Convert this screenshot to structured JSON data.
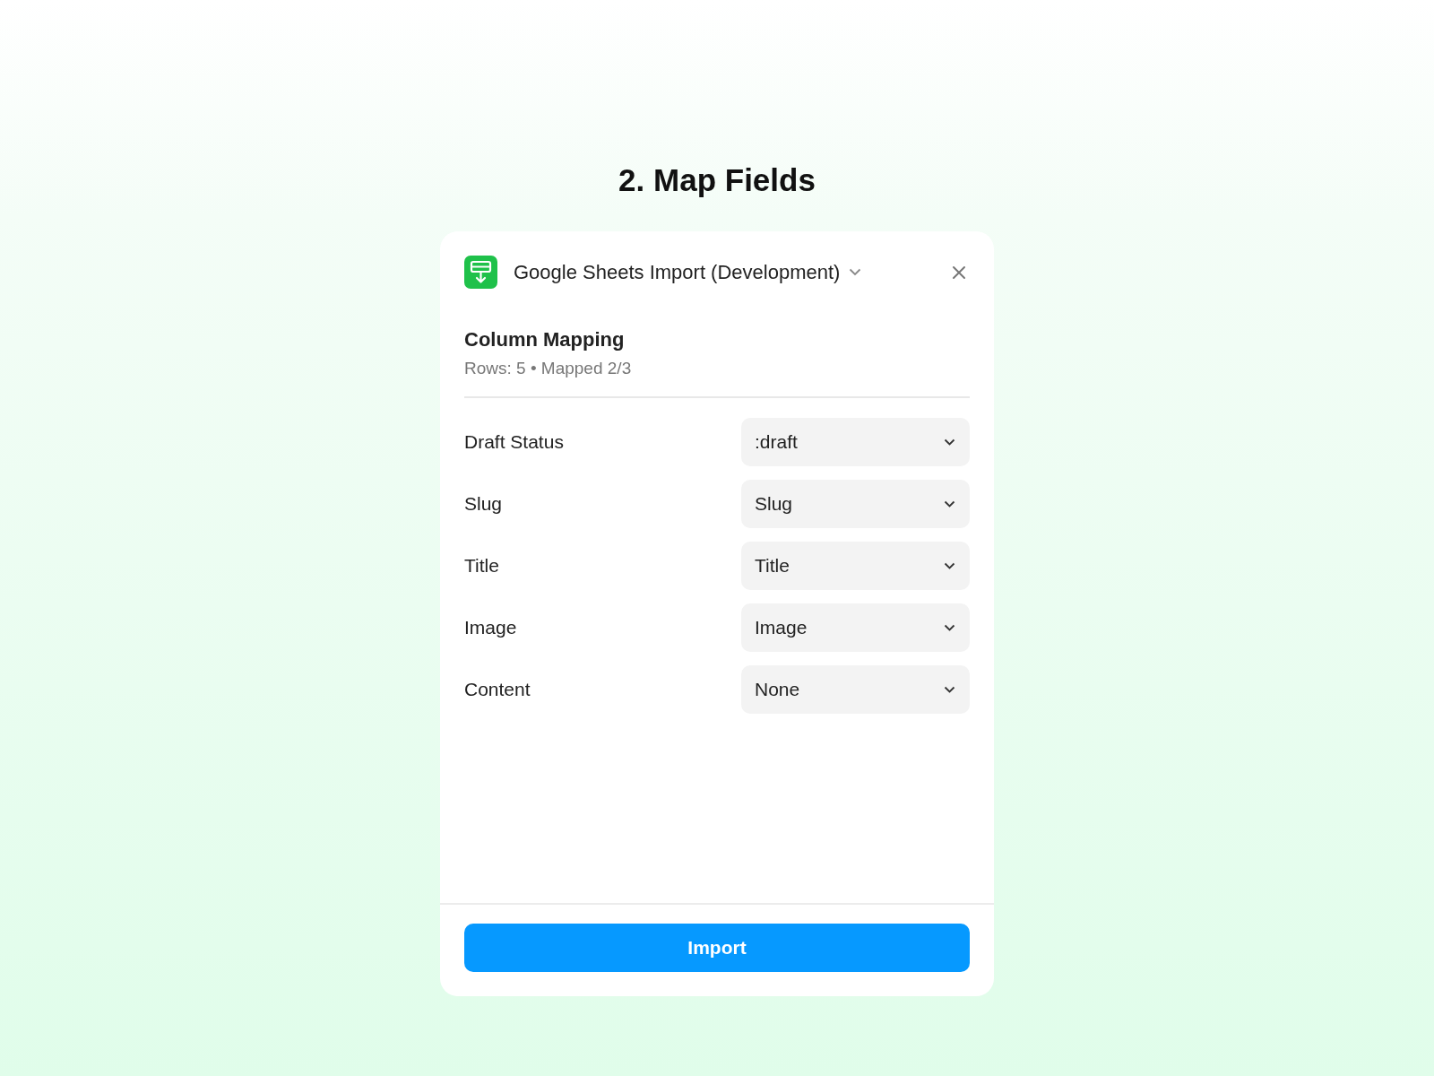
{
  "page_title": "2. Map Fields",
  "panel": {
    "title": "Google Sheets Import (Development)",
    "section_title": "Column Mapping",
    "summary": "Rows: 5 • Mapped 2/3",
    "mappings": [
      {
        "field": "Draft Status",
        "value": ":draft"
      },
      {
        "field": "Slug",
        "value": "Slug"
      },
      {
        "field": "Title",
        "value": "Title"
      },
      {
        "field": "Image",
        "value": "Image"
      },
      {
        "field": "Content",
        "value": "None"
      }
    ],
    "button": "Import"
  }
}
